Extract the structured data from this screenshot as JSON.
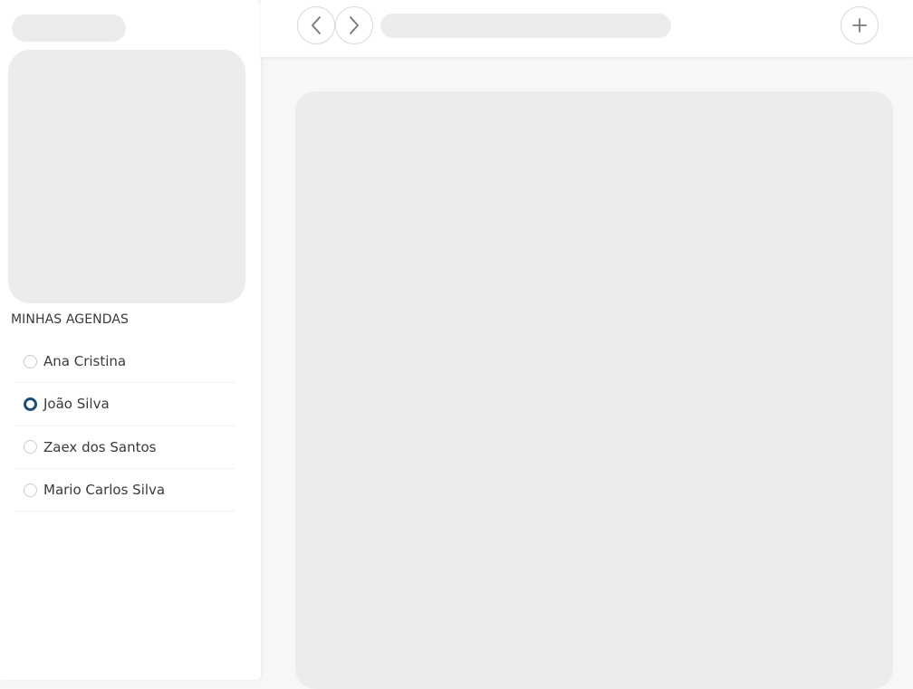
{
  "sidebar": {
    "section_title": "MINHAS AGENDAS",
    "agendas": [
      {
        "label": "Ana Cristina",
        "selected": false
      },
      {
        "label": "João Silva",
        "selected": true
      },
      {
        "label": "Zaex dos Santos",
        "selected": false
      },
      {
        "label": "Mario Carlos Silva",
        "selected": false
      }
    ]
  },
  "toolbar": {
    "prev_icon": "chevron-left-icon",
    "next_icon": "chevron-right-icon",
    "add_icon": "plus-icon"
  },
  "colors": {
    "accent": "#1e4d78",
    "skeleton": "#ececec",
    "text": "#3a3a3a"
  }
}
